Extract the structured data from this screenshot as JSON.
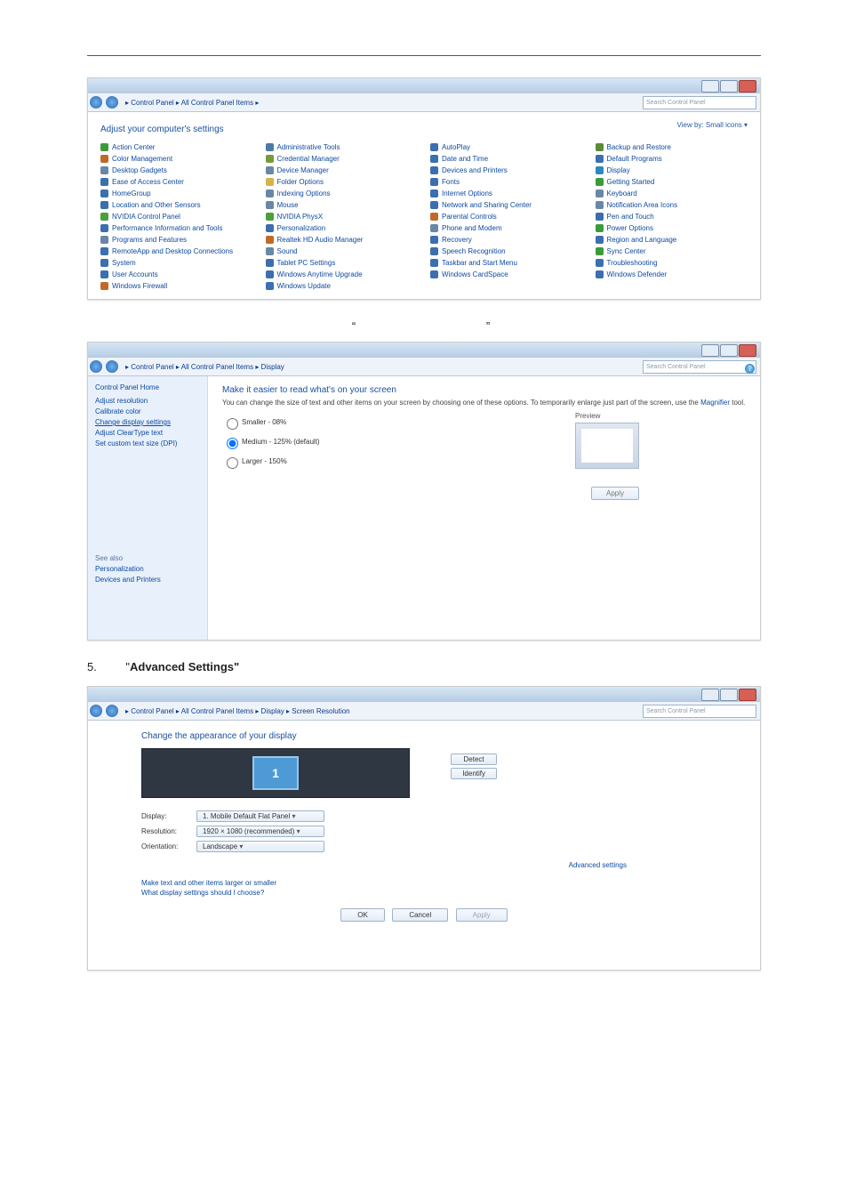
{
  "step5": {
    "num": "5.",
    "pre": "\"",
    "bold": "Advanced Settings\"",
    "post": ""
  },
  "quotes": {
    "open": "“",
    "close": "”"
  },
  "s1": {
    "crumb": "▸ Control Panel ▸ All Control Panel Items ▸",
    "search": "Search Control Panel",
    "heading": "Adjust your computer's settings",
    "viewby": "View by:  Small icons ▾",
    "items": [
      {
        "n": "Action Center",
        "c": "#3b9b3b"
      },
      {
        "n": "Administrative Tools",
        "c": "#4c7aa6"
      },
      {
        "n": "AutoPlay",
        "c": "#3b6fb0"
      },
      {
        "n": "Backup and Restore",
        "c": "#5b8a39"
      },
      {
        "n": "Color Management",
        "c": "#c06a2a"
      },
      {
        "n": "Credential Manager",
        "c": "#7a9a3a"
      },
      {
        "n": "Date and Time",
        "c": "#3b6fb0"
      },
      {
        "n": "Default Programs",
        "c": "#3b6fb0"
      },
      {
        "n": "Desktop Gadgets",
        "c": "#6a87a5"
      },
      {
        "n": "Device Manager",
        "c": "#6a87a5"
      },
      {
        "n": "Devices and Printers",
        "c": "#3b6fb0"
      },
      {
        "n": "Display",
        "c": "#2a8ac0"
      },
      {
        "n": "Ease of Access Center",
        "c": "#3b6fb0"
      },
      {
        "n": "Folder Options",
        "c": "#d8b24a"
      },
      {
        "n": "Fonts",
        "c": "#3b6fb0"
      },
      {
        "n": "Getting Started",
        "c": "#3b9b3b"
      },
      {
        "n": "HomeGroup",
        "c": "#3b6fb0"
      },
      {
        "n": "Indexing Options",
        "c": "#6a87a5"
      },
      {
        "n": "Internet Options",
        "c": "#3b6fb0"
      },
      {
        "n": "Keyboard",
        "c": "#6a87a5"
      },
      {
        "n": "Location and Other Sensors",
        "c": "#3b6fb0"
      },
      {
        "n": "Mouse",
        "c": "#6a87a5"
      },
      {
        "n": "Network and Sharing Center",
        "c": "#3b6fb0"
      },
      {
        "n": "Notification Area Icons",
        "c": "#6a87a5"
      },
      {
        "n": "NVIDIA Control Panel",
        "c": "#4aa03a"
      },
      {
        "n": "NVIDIA PhysX",
        "c": "#4aa03a"
      },
      {
        "n": "Parental Controls",
        "c": "#c06a2a"
      },
      {
        "n": "Pen and Touch",
        "c": "#3b6fb0"
      },
      {
        "n": "Performance Information and Tools",
        "c": "#3b6fb0"
      },
      {
        "n": "Personalization",
        "c": "#3b6fb0"
      },
      {
        "n": "Phone and Modem",
        "c": "#6a87a5"
      },
      {
        "n": "Power Options",
        "c": "#3b9b3b"
      },
      {
        "n": "Programs and Features",
        "c": "#6a87a5"
      },
      {
        "n": "Realtek HD Audio Manager",
        "c": "#c06a2a"
      },
      {
        "n": "Recovery",
        "c": "#3b6fb0"
      },
      {
        "n": "Region and Language",
        "c": "#3b6fb0"
      },
      {
        "n": "RemoteApp and Desktop Connections",
        "c": "#3b6fb0"
      },
      {
        "n": "Sound",
        "c": "#6a87a5"
      },
      {
        "n": "Speech Recognition",
        "c": "#3b6fb0"
      },
      {
        "n": "Sync Center",
        "c": "#3b9b3b"
      },
      {
        "n": "System",
        "c": "#3b6fb0"
      },
      {
        "n": "Tablet PC Settings",
        "c": "#3b6fb0"
      },
      {
        "n": "Taskbar and Start Menu",
        "c": "#3b6fb0"
      },
      {
        "n": "Troubleshooting",
        "c": "#3b6fb0"
      },
      {
        "n": "User Accounts",
        "c": "#3b6fb0"
      },
      {
        "n": "Windows Anytime Upgrade",
        "c": "#3b6fb0"
      },
      {
        "n": "Windows CardSpace",
        "c": "#3b6fb0"
      },
      {
        "n": "Windows Defender",
        "c": "#3b6fb0"
      },
      {
        "n": "Windows Firewall",
        "c": "#c06a2a"
      },
      {
        "n": "Windows Update",
        "c": "#3b6fb0"
      }
    ]
  },
  "s2": {
    "crumb": "▸ Control Panel ▸ All Control Panel Items ▸ Display",
    "search": "Search Control Panel",
    "side_hdr": "Control Panel Home",
    "side_links": [
      "Adjust resolution",
      "Calibrate color",
      "Change display settings",
      "Adjust ClearType text",
      "Set custom text size (DPI)"
    ],
    "side_current": 2,
    "see_also": "See also",
    "see_links": [
      "Personalization",
      "Devices and Printers"
    ],
    "title": "Make it easier to read what's on your screen",
    "desc_a": "You can change the size of text and other items on your screen by choosing one of these options. To temporarily enlarge just part of the screen, use the ",
    "desc_link": "Magnifier",
    "desc_b": " tool.",
    "opts": [
      {
        "label": "Smaller - 08%",
        "checked": false
      },
      {
        "label": "Medium - 125% (default)",
        "checked": true
      },
      {
        "label": "Larger - 150%",
        "checked": false
      }
    ],
    "preview": "Preview",
    "apply": "Apply"
  },
  "s3": {
    "crumb": "▸ Control Panel ▸ All Control Panel Items ▸ Display ▸ Screen Resolution",
    "search": "Search Control Panel",
    "title": "Change the appearance of your display",
    "mon_num": "1",
    "detect": "Detect",
    "identify": "Identify",
    "rows": [
      {
        "lab": "Display:",
        "val": "1. Mobile Default Flat Panel"
      },
      {
        "lab": "Resolution:",
        "val": "1920 × 1080 (recommended)"
      },
      {
        "lab": "Orientation:",
        "val": "Landscape"
      }
    ],
    "advanced": "Advanced settings",
    "links": [
      "Make text and other items larger or smaller",
      "What display settings should I choose?"
    ],
    "ok": "OK",
    "cancel": "Cancel",
    "apply": "Apply"
  }
}
